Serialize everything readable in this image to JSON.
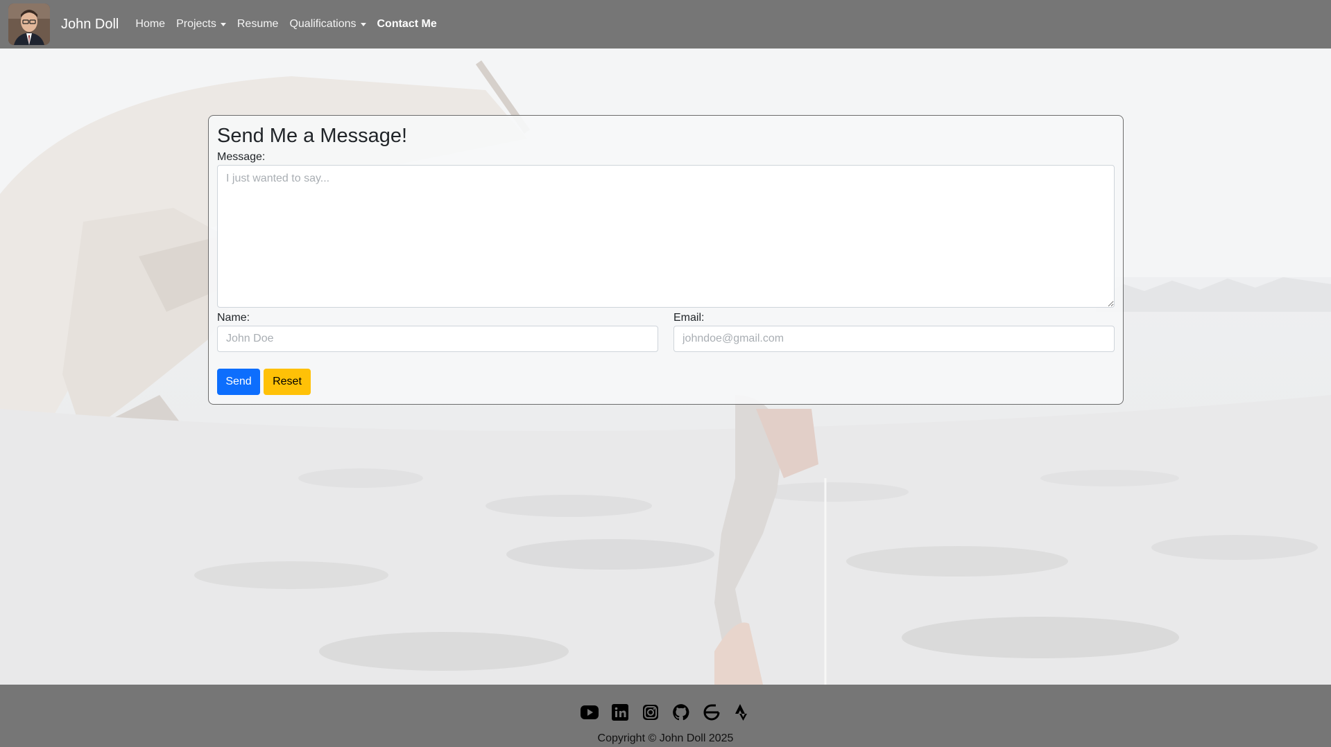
{
  "nav": {
    "brand_name": "John Doll",
    "items": [
      {
        "label": "Home"
      },
      {
        "label": "Projects"
      },
      {
        "label": "Resume"
      },
      {
        "label": "Qualifications"
      },
      {
        "label": "Contact Me"
      }
    ],
    "active_item": "Contact Me"
  },
  "form": {
    "title": "Send Me a Message!",
    "message_label": "Message:",
    "message_placeholder": "I just wanted to say...",
    "name_label": "Name:",
    "name_placeholder": "John Doe",
    "email_label": "Email:",
    "email_placeholder": "johndoe@gmail.com",
    "send_label": "Send",
    "reset_label": "Reset"
  },
  "footer": {
    "social_icons": [
      "youtube-icon",
      "linkedin-icon",
      "instagram-icon",
      "github-icon",
      "geocaching-icon",
      "strava-icon"
    ],
    "copyright": "Copyright © John Doll 2025"
  },
  "colors": {
    "navbar_bg": "#767676",
    "send_button": "#0d6efd",
    "reset_button": "#ffc107"
  }
}
